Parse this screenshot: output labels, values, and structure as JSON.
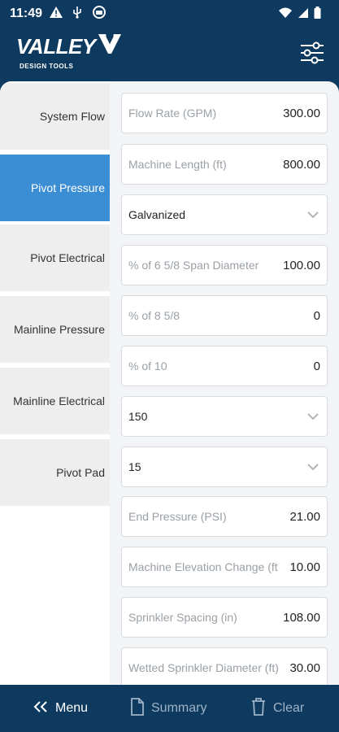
{
  "status": {
    "time": "11:49"
  },
  "brand": {
    "logo_text": "VALLEY",
    "subtitle": "DESIGN TOOLS"
  },
  "colors": {
    "brand_navy": "#0f3a5f",
    "active_blue": "#3b8ed4"
  },
  "sidebar": {
    "items": [
      {
        "label": "System Flow"
      },
      {
        "label": "Pivot Pressure"
      },
      {
        "label": "Pivot Electrical"
      },
      {
        "label": "Mainline Pressure"
      },
      {
        "label": "Mainline Electrical"
      },
      {
        "label": "Pivot Pad"
      }
    ],
    "active_index": 1
  },
  "form": {
    "flow_rate": {
      "placeholder": "Flow Rate (GPM)",
      "value": "300.00"
    },
    "machine_length": {
      "placeholder": "Machine Length (ft)",
      "value": "800.00"
    },
    "pipe_material": {
      "value": "Galvanized"
    },
    "pct_6_5_8": {
      "placeholder": "% of 6 5/8 Span Diameter",
      "value": "100.00"
    },
    "pct_8_5_8": {
      "placeholder": "% of 8 5/8",
      "value": "0"
    },
    "pct_10": {
      "placeholder": "% of 10",
      "value": "0"
    },
    "select_150": {
      "value": "150"
    },
    "select_15": {
      "value": "15"
    },
    "end_pressure": {
      "placeholder": "End Pressure (PSI)",
      "value": "21.00"
    },
    "elevation_change": {
      "placeholder": "Machine Elevation Change (ft",
      "value": "10.00"
    },
    "sprinkler_spacing": {
      "placeholder": "Sprinkler Spacing (in)",
      "value": "108.00"
    },
    "wetted_diameter": {
      "placeholder": "Wetted Sprinkler Diameter (ft)",
      "value": "30.00"
    }
  },
  "bottom": {
    "menu_label": "Menu",
    "summary_label": "Summary",
    "clear_label": "Clear"
  },
  "icons": [
    "alert-icon",
    "usb-icon",
    "app-icon",
    "wifi-icon",
    "signal-icon",
    "battery-icon",
    "filter-sliders-icon",
    "chevron-down-icon",
    "double-chevron-left-icon",
    "document-icon",
    "trash-icon"
  ]
}
